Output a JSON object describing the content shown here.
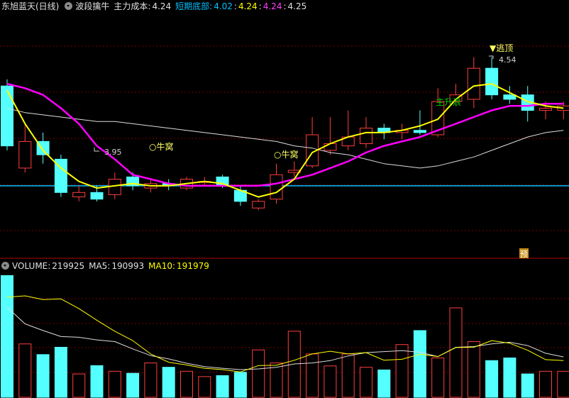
{
  "main_header": {
    "title": "东旭蓝天(日线)",
    "indicator_name": "波段擒牛",
    "cost_label": "主力成本:",
    "cost_value": "4.24",
    "bottom_label": "短期底部:",
    "v1": "4.02",
    "v2": "4.24",
    "v3": "4.24",
    "v4": "4.25",
    "sep": ":"
  },
  "volume_header": {
    "volume_label": "VOLUME:",
    "volume_value": "219925",
    "ma5_label": "MA5:",
    "ma5_value": "190993",
    "ma10_label": "MA10:",
    "ma10_value": "191979"
  },
  "annotations": {
    "escape_top": "▼逃顶",
    "high_price": "4.54",
    "low_price": "3.95",
    "bull_nest_1": "○牛窝",
    "bull_nest_2": "○牛窝",
    "main_rise": "主升浪",
    "forecast_badge": "预"
  },
  "colors": {
    "up": "#ff3d3d",
    "down": "#54ffff",
    "ma_yellow": "#ffff00",
    "ma_magenta": "#ff00ff",
    "ma_white": "#dcdcdc",
    "cyan_line": "#00c0ff",
    "green_text": "#00d000",
    "grid": "#7a0000"
  },
  "chart_data": {
    "type": "candlestick",
    "price_ylim": [
      3.7,
      4.8
    ],
    "reference_line": 4.02,
    "candles": [
      {
        "o": 4.47,
        "c": 4.2,
        "h": 4.5,
        "l": 4.18
      },
      {
        "o": 4.1,
        "c": 4.22,
        "h": 4.3,
        "l": 4.08
      },
      {
        "o": 4.22,
        "c": 4.16,
        "h": 4.26,
        "l": 4.12
      },
      {
        "o": 4.14,
        "c": 3.99,
        "h": 4.16,
        "l": 3.97
      },
      {
        "o": 3.97,
        "c": 3.99,
        "h": 4.02,
        "l": 3.95
      },
      {
        "o": 3.99,
        "c": 3.96,
        "h": 4.02,
        "l": 3.95
      },
      {
        "o": 3.98,
        "c": 4.05,
        "h": 4.08,
        "l": 3.96
      },
      {
        "o": 4.06,
        "c": 4.02,
        "h": 4.08,
        "l": 4.0
      },
      {
        "o": 4.01,
        "c": 4.03,
        "h": 4.05,
        "l": 3.99
      },
      {
        "o": 4.03,
        "c": 4.02,
        "h": 4.05,
        "l": 4.0
      },
      {
        "o": 4.01,
        "c": 4.05,
        "h": 4.06,
        "l": 4.0
      },
      {
        "o": 4.04,
        "c": 4.04,
        "h": 4.06,
        "l": 4.02
      },
      {
        "o": 4.06,
        "c": 4.02,
        "h": 4.07,
        "l": 4.01
      },
      {
        "o": 4.0,
        "c": 3.95,
        "h": 4.02,
        "l": 3.93
      },
      {
        "o": 3.92,
        "c": 3.95,
        "h": 3.96,
        "l": 3.91
      },
      {
        "o": 3.96,
        "c": 4.07,
        "h": 4.12,
        "l": 3.94
      },
      {
        "o": 4.08,
        "c": 4.09,
        "h": 4.13,
        "l": 4.06
      },
      {
        "o": 4.11,
        "c": 4.25,
        "h": 4.33,
        "l": 4.1
      },
      {
        "o": 4.18,
        "c": 4.21,
        "h": 4.33,
        "l": 4.16
      },
      {
        "o": 4.2,
        "c": 4.24,
        "h": 4.36,
        "l": 4.18
      },
      {
        "o": 4.21,
        "c": 4.28,
        "h": 4.33,
        "l": 4.19
      },
      {
        "o": 4.28,
        "c": 4.26,
        "h": 4.3,
        "l": 4.23
      },
      {
        "o": 4.26,
        "c": 4.27,
        "h": 4.3,
        "l": 4.23
      },
      {
        "o": 4.27,
        "c": 4.26,
        "h": 4.36,
        "l": 4.25
      },
      {
        "o": 4.25,
        "c": 4.4,
        "h": 4.46,
        "l": 4.24
      },
      {
        "o": 4.4,
        "c": 4.43,
        "h": 4.48,
        "l": 4.38
      },
      {
        "o": 4.41,
        "c": 4.55,
        "h": 4.6,
        "l": 4.37
      },
      {
        "o": 4.55,
        "c": 4.43,
        "h": 4.6,
        "l": 4.41
      },
      {
        "o": 4.43,
        "c": 4.41,
        "h": 4.47,
        "l": 4.39
      },
      {
        "o": 4.43,
        "c": 4.36,
        "h": 4.47,
        "l": 4.31
      },
      {
        "o": 4.36,
        "c": 4.37,
        "h": 4.4,
        "l": 4.32
      },
      {
        "o": 4.36,
        "c": 4.38,
        "h": 4.4,
        "l": 4.32
      }
    ],
    "line_yellow": [
      4.45,
      4.3,
      4.18,
      4.1,
      4.04,
      4.01,
      4.02,
      4.03,
      4.02,
      4.02,
      4.03,
      4.04,
      4.03,
      4.0,
      3.97,
      3.99,
      4.05,
      4.17,
      4.21,
      4.24,
      4.26,
      4.26,
      4.27,
      4.29,
      4.32,
      4.41,
      4.47,
      4.48,
      4.44,
      4.4,
      4.38,
      4.37
    ],
    "line_magenta": [
      4.48,
      4.46,
      4.43,
      4.37,
      4.3,
      4.2,
      4.14,
      4.07,
      4.05,
      4.03,
      4.02,
      4.02,
      4.02,
      4.02,
      4.02,
      4.03,
      4.05,
      4.07,
      4.1,
      4.13,
      4.17,
      4.2,
      4.22,
      4.24,
      4.27,
      4.3,
      4.33,
      4.36,
      4.38,
      4.38,
      4.39,
      4.39
    ],
    "line_white": [
      4.37,
      4.35,
      4.34,
      4.33,
      4.32,
      4.31,
      4.31,
      4.3,
      4.29,
      4.28,
      4.27,
      4.26,
      4.25,
      4.24,
      4.23,
      4.22,
      4.2,
      4.19,
      4.17,
      4.16,
      4.14,
      4.12,
      4.11,
      4.1,
      4.11,
      4.13,
      4.15,
      4.18,
      4.21,
      4.24,
      4.26,
      4.27
    ],
    "volume_ylim": [
      0,
      370000
    ],
    "volumes": [
      365000,
      160000,
      128000,
      150000,
      70000,
      95000,
      78000,
      72000,
      103000,
      90000,
      78000,
      62000,
      65000,
      75000,
      142000,
      103000,
      198000,
      130000,
      94000,
      130000,
      90000,
      82000,
      158000,
      200000,
      118000,
      268000,
      167000,
      110000,
      118000,
      70000,
      78000,
      78000
    ],
    "vol_ma_yellow": [
      300000,
      304000,
      293000,
      295000,
      266000,
      231000,
      198000,
      170000,
      130000,
      105000,
      97000,
      87000,
      83000,
      76000,
      95000,
      96000,
      111000,
      130000,
      138000,
      130000,
      134000,
      111000,
      114000,
      129000,
      122000,
      149000,
      150000,
      170000,
      162000,
      141000,
      113000,
      110000
    ],
    "vol_ma_white": [
      270000,
      220000,
      200000,
      182000,
      180000,
      172000,
      167000,
      145000,
      125000,
      115000,
      102000,
      92000,
      87000,
      83000,
      85000,
      90000,
      100000,
      103000,
      110000,
      124000,
      134000,
      137000,
      140000,
      135000,
      122000,
      150000,
      152000,
      160000,
      165000,
      155000,
      132000,
      121000
    ]
  }
}
